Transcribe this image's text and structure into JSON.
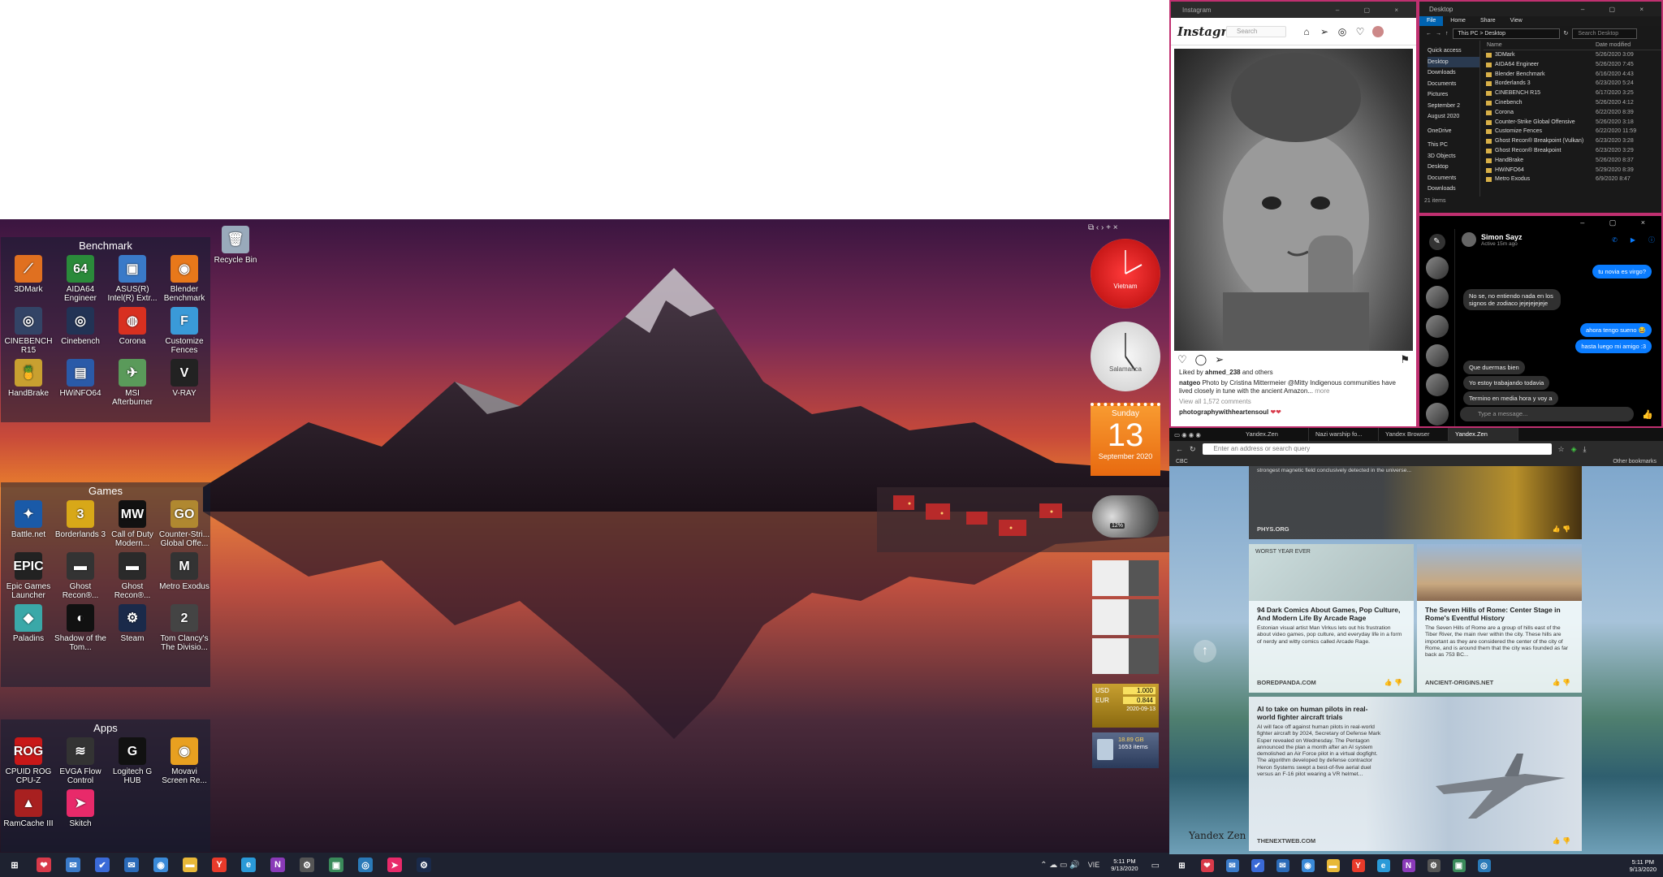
{
  "left_monitor": {
    "recycle_bin_label": "Recycle Bin",
    "fences": [
      {
        "title": "Benchmark",
        "items": [
          {
            "label": "3DMark",
            "icon": "3dmark-icon",
            "color": "#e07020",
            "glyph": "⟋"
          },
          {
            "label": "AIDA64 Engineer",
            "icon": "aida64-icon",
            "color": "#2a8a3a",
            "glyph": "64"
          },
          {
            "label": "ASUS(R) Intel(R) Extr...",
            "icon": "asus-icon",
            "color": "#3a7ac8",
            "glyph": "▣"
          },
          {
            "label": "Blender Benchmark",
            "icon": "blender-icon",
            "color": "#e8781a",
            "glyph": "◉"
          },
          {
            "label": "CINEBENCH R15",
            "icon": "cinebench-r15-icon",
            "color": "#334466",
            "glyph": "◎"
          },
          {
            "label": "Cinebench",
            "icon": "cinebench-icon",
            "color": "#223355",
            "glyph": "◎"
          },
          {
            "label": "Corona",
            "icon": "corona-icon",
            "color": "#d83020",
            "glyph": "◍"
          },
          {
            "label": "Customize Fences",
            "icon": "fences-icon",
            "color": "#3a9ad8",
            "glyph": "F"
          },
          {
            "label": "HandBrake",
            "icon": "handbrake-icon",
            "color": "#c8a030",
            "glyph": "🍍"
          },
          {
            "label": "HWiNFO64",
            "icon": "hwinfo-icon",
            "color": "#2a5aa8",
            "glyph": "▤"
          },
          {
            "label": "MSI Afterburner",
            "icon": "afterburner-icon",
            "color": "#5a9a5a",
            "glyph": "✈"
          },
          {
            "label": "V-RAY",
            "icon": "vray-icon",
            "color": "#222222",
            "glyph": "V"
          }
        ]
      },
      {
        "title": "Games",
        "items": [
          {
            "label": "Battle.net",
            "icon": "battlenet-icon",
            "color": "#1a5aa8",
            "glyph": "✦"
          },
          {
            "label": "Borderlands 3",
            "icon": "borderlands-icon",
            "color": "#d8a818",
            "glyph": "3"
          },
          {
            "label": "Call of Duty Modern...",
            "icon": "cod-icon",
            "color": "#111111",
            "glyph": "MW"
          },
          {
            "label": "Counter-Stri... Global Offe...",
            "icon": "csgo-icon",
            "color": "#b08830",
            "glyph": "GO"
          },
          {
            "label": "Epic Games Launcher",
            "icon": "epic-icon",
            "color": "#222222",
            "glyph": "EPIC"
          },
          {
            "label": "Ghost Recon®...",
            "icon": "ghost-recon-icon",
            "color": "#333333",
            "glyph": "▬"
          },
          {
            "label": "Ghost Recon®...",
            "icon": "ghost-recon-2-icon",
            "color": "#2a2a2a",
            "glyph": "▬"
          },
          {
            "label": "Metro Exodus",
            "icon": "metro-icon",
            "color": "#333333",
            "glyph": "M"
          },
          {
            "label": "Paladins",
            "icon": "paladins-icon",
            "color": "#3aa8a8",
            "glyph": "◆"
          },
          {
            "label": "Shadow of the Tom...",
            "icon": "tomb-raider-icon",
            "color": "#111111",
            "glyph": "◐"
          },
          {
            "label": "Steam",
            "icon": "steam-icon",
            "color": "#1a2a4a",
            "glyph": "⚙"
          },
          {
            "label": "Tom Clancy's The Divisio...",
            "icon": "division-icon",
            "color": "#444444",
            "glyph": "2"
          }
        ]
      },
      {
        "title": "Apps",
        "items": [
          {
            "label": "CPUID ROG CPU-Z",
            "icon": "cpuz-icon",
            "color": "#c81818",
            "glyph": "ROG"
          },
          {
            "label": "EVGA Flow Control",
            "icon": "evga-icon",
            "color": "#333333",
            "glyph": "≋"
          },
          {
            "label": "Logitech G HUB",
            "icon": "ghub-icon",
            "color": "#111111",
            "glyph": "G"
          },
          {
            "label": "Movavi Screen Re...",
            "icon": "movavi-icon",
            "color": "#e8a020",
            "glyph": "◉"
          },
          {
            "label": "RamCache III",
            "icon": "ramcache-icon",
            "color": "#a82020",
            "glyph": "▲"
          },
          {
            "label": "Skitch",
            "icon": "skitch-icon",
            "color": "#e82a6a",
            "glyph": "➤"
          }
        ]
      }
    ],
    "gadgets": {
      "clock1_label": "Vietnam",
      "clock2_label": "Salamanca",
      "calendar_day": "Sunday",
      "calendar_date": "13",
      "calendar_month": "September 2020",
      "cpu_pct": "12%",
      "currency": [
        {
          "code": "USD",
          "value": "1.000"
        },
        {
          "code": "EUR",
          "value": "0.844"
        }
      ],
      "currency_date": "2020-09-13",
      "bin_size": "18.89 GB",
      "bin_items": "1653 items"
    },
    "taskbar": {
      "time": "5:11 PM",
      "date": "9/13/2020",
      "lang": "VIE",
      "icons": [
        {
          "name": "start-icon",
          "color": "#ffffff",
          "glyph": "⊞"
        },
        {
          "name": "pocket-icon",
          "color": "#d83a4a",
          "glyph": "❤"
        },
        {
          "name": "mail-icon",
          "color": "#3a7ac8",
          "glyph": "✉"
        },
        {
          "name": "todo-icon",
          "color": "#3a6ad8",
          "glyph": "✔"
        },
        {
          "name": "outlook-icon",
          "color": "#2a6ab8",
          "glyph": "✉"
        },
        {
          "name": "chrome-icon",
          "color": "#3a8ad8",
          "glyph": "◉"
        },
        {
          "name": "explorer-icon",
          "color": "#e8b838",
          "glyph": "▬"
        },
        {
          "name": "yandex-icon",
          "color": "#e83a2a",
          "glyph": "Y"
        },
        {
          "name": "edge-icon",
          "color": "#2a9ad8",
          "glyph": "e"
        },
        {
          "name": "onenote-icon",
          "color": "#8a3ab8",
          "glyph": "N"
        },
        {
          "name": "settings-icon",
          "color": "#555555",
          "glyph": "⚙"
        },
        {
          "name": "photos-icon",
          "color": "#3a8a5a",
          "glyph": "▣"
        },
        {
          "name": "camera-icon",
          "color": "#2a7ab8",
          "glyph": "◎"
        },
        {
          "name": "skitch-taskbar-icon",
          "color": "#e82a6a",
          "glyph": "➤"
        },
        {
          "name": "steam-taskbar-icon",
          "color": "#1a2a4a",
          "glyph": "⚙"
        }
      ]
    }
  },
  "instagram": {
    "window_title": "Instagram",
    "logo": "Instagram",
    "search_placeholder": "Search",
    "liked_by_prefix": "Liked by",
    "liked_by_user": "ahmed_238",
    "liked_by_suffix": "and others",
    "caption_user": "natgeo",
    "caption": "Photo by Cristina Mittermeier @Mitty Indigenous communities have lived closely in tune with the ancient Amazon...",
    "more": "more",
    "view_comments": "View all 1,572 comments",
    "comment_user": "photographywithheartensoul",
    "comment_text": "❤❤"
  },
  "explorer": {
    "window_title": "Desktop",
    "ribbon": [
      "File",
      "Home",
      "Share",
      "View"
    ],
    "address": "This PC > Desktop",
    "search_placeholder": "Search Desktop",
    "col_name": "Name",
    "col_date": "Date modified",
    "nav": [
      "Quick access",
      "Desktop",
      "Downloads",
      "Documents",
      "Pictures",
      "September 2",
      "August 2020",
      "OneDrive",
      "This PC",
      "3D Objects",
      "Desktop",
      "Documents",
      "Downloads"
    ],
    "files": [
      {
        "name": "3DMark",
        "date": "5/26/2020 3:09"
      },
      {
        "name": "AIDA64 Engineer",
        "date": "5/26/2020 7:45"
      },
      {
        "name": "Blender Benchmark",
        "date": "6/16/2020 4:43"
      },
      {
        "name": "Borderlands 3",
        "date": "6/23/2020 5:24"
      },
      {
        "name": "CINEBENCH R15",
        "date": "6/17/2020 3:25"
      },
      {
        "name": "Cinebench",
        "date": "5/26/2020 4:12"
      },
      {
        "name": "Corona",
        "date": "6/22/2020 8:39"
      },
      {
        "name": "Counter-Strike Global Offensive",
        "date": "5/26/2020 3:18"
      },
      {
        "name": "Customize Fences",
        "date": "6/22/2020 11:59"
      },
      {
        "name": "Ghost Recon® Breakpoint (Vulkan)",
        "date": "6/23/2020 3:28"
      },
      {
        "name": "Ghost Recon® Breakpoint",
        "date": "6/23/2020 3:29"
      },
      {
        "name": "HandBrake",
        "date": "5/26/2020 8:37"
      },
      {
        "name": "HWiNFO64",
        "date": "5/29/2020 8:39"
      },
      {
        "name": "Metro Exodus",
        "date": "6/9/2020 8:47"
      }
    ],
    "status": "21 items"
  },
  "messenger": {
    "contact_name": "Simon Sayz",
    "contact_status": "Active 15m ago",
    "messages": [
      {
        "dir": "out",
        "text": "tu novia es virgo?"
      },
      {
        "dir": "in",
        "text": "No se, no entiendo nada en los signos de zodiaco jejejejejeje"
      },
      {
        "dir": "out",
        "text": "ahora tengo sueno 😂"
      },
      {
        "dir": "out",
        "text": "hasta luego mi amigo :3"
      },
      {
        "dir": "in",
        "text": "Que duermas bien"
      },
      {
        "dir": "in",
        "text": "Yo estoy trabajando todavia"
      },
      {
        "dir": "in",
        "text": "Termino en media hora y voy a"
      }
    ],
    "input_placeholder": "Type a message..."
  },
  "browser": {
    "tabs": [
      "Yandex.Zen",
      "Nazi warship fo...",
      "Yandex Browser",
      "Yandex.Zen"
    ],
    "url_placeholder": "Enter an address or search query",
    "bookmark_left": "CBC",
    "bookmark_right": "Other bookmarks",
    "logo": "Yandex Zen",
    "cards": [
      {
        "title": "",
        "body": "strongest magnetic field conclusively detected in the universe...",
        "source": "PHYS.ORG"
      },
      {
        "title": "94 Dark Comics About Games, Pop Culture, And Modern Life By Arcade Rage",
        "body": "Estonian visual artist Man Virkus lets out his frustration about video games, pop culture, and everyday life in a form of nerdy and witty comics called Arcade Rage.",
        "source": "BOREDPANDA.COM"
      },
      {
        "title": "The Seven Hills of Rome: Center Stage in Rome's Eventful History",
        "body": "The Seven Hills of Rome are a group of hills east of the Tiber River, the main river within the city. These hills are important as they are considered the center of the city of Rome, and is around them that the city was founded as far back as 753 BC...",
        "source": "ANCIENT-ORIGINS.NET"
      },
      {
        "title": "AI to take on human pilots in real-world fighter aircraft trials",
        "body": "AI will face off against human pilots in real-world fighter aircraft by 2024, Secretary of Defense Mark Esper revealed on Wednesday. The Pentagon announced the plan a month after an AI system demolished an Air Force pilot in a virtual dogfight. The algorithm developed by defense contractor Heron Systems swept a best-of-five aerial duel versus an F-16 pilot wearing a VR helmet...",
        "source": "THENEXTWEB.COM"
      }
    ],
    "comic_caption": "WORST YEAR EVER"
  },
  "taskbar_right": {
    "time": "5:11 PM",
    "date": "9/13/2020"
  }
}
